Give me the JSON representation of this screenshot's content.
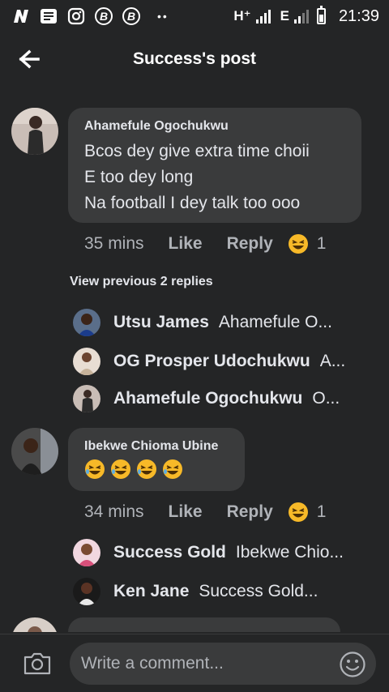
{
  "status_bar": {
    "left_icons": [
      "n-app-icon",
      "message-icon",
      "instagram-icon",
      "b-app-icon",
      "b-app-icon-2"
    ],
    "dots": "••",
    "network_1": "H⁺",
    "network_2": "E",
    "time": "21:39"
  },
  "header": {
    "title": "Success's post",
    "back_icon": "arrow-left-icon"
  },
  "comments": [
    {
      "author": "Ahamefule Ogochukwu",
      "lines": [
        "Bcos dey give extra time choii",
        "E too dey long",
        "Na football I dey talk too ooo"
      ],
      "time": "35 mins",
      "like": "Like",
      "reply": "Reply",
      "reaction_count": "1",
      "view_previous": "View previous 2 replies",
      "replies": [
        {
          "name": "Utsu James",
          "text": "Ahamefule O..."
        },
        {
          "name": "OG Prosper Udochukwu",
          "text": "A..."
        },
        {
          "name": "Ahamefule Ogochukwu",
          "text": "O..."
        }
      ]
    },
    {
      "author": "Ibekwe Chioma Ubine",
      "emoji_count": 4,
      "time": "34 mins",
      "like": "Like",
      "reply": "Reply",
      "reaction_count": "1",
      "replies": [
        {
          "name": "Success Gold",
          "text": "Ibekwe Chio..."
        },
        {
          "name": "Ken Jane",
          "text": "Success Gold..."
        }
      ]
    }
  ],
  "composer": {
    "placeholder": "Write a comment...",
    "camera_icon": "camera-icon",
    "emoji_icon": "smiley-icon"
  },
  "colors": {
    "background": "#242526",
    "bubble": "#3a3b3c",
    "text": "#e4e6eb",
    "muted": "#b0b3b8",
    "emoji": "#f7b928"
  }
}
